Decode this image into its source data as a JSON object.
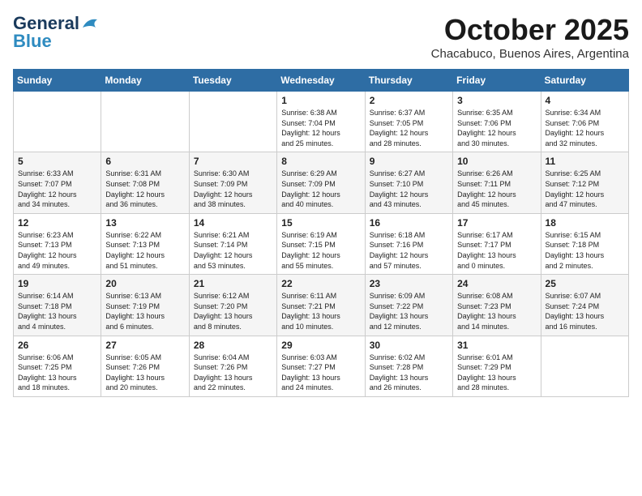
{
  "logo": {
    "line1": "General",
    "line2": "Blue"
  },
  "title": "October 2025",
  "subtitle": "Chacabuco, Buenos Aires, Argentina",
  "days_of_week": [
    "Sunday",
    "Monday",
    "Tuesday",
    "Wednesday",
    "Thursday",
    "Friday",
    "Saturday"
  ],
  "weeks": [
    [
      {
        "day": "",
        "content": ""
      },
      {
        "day": "",
        "content": ""
      },
      {
        "day": "",
        "content": ""
      },
      {
        "day": "1",
        "content": "Sunrise: 6:38 AM\nSunset: 7:04 PM\nDaylight: 12 hours\nand 25 minutes."
      },
      {
        "day": "2",
        "content": "Sunrise: 6:37 AM\nSunset: 7:05 PM\nDaylight: 12 hours\nand 28 minutes."
      },
      {
        "day": "3",
        "content": "Sunrise: 6:35 AM\nSunset: 7:06 PM\nDaylight: 12 hours\nand 30 minutes."
      },
      {
        "day": "4",
        "content": "Sunrise: 6:34 AM\nSunset: 7:06 PM\nDaylight: 12 hours\nand 32 minutes."
      }
    ],
    [
      {
        "day": "5",
        "content": "Sunrise: 6:33 AM\nSunset: 7:07 PM\nDaylight: 12 hours\nand 34 minutes."
      },
      {
        "day": "6",
        "content": "Sunrise: 6:31 AM\nSunset: 7:08 PM\nDaylight: 12 hours\nand 36 minutes."
      },
      {
        "day": "7",
        "content": "Sunrise: 6:30 AM\nSunset: 7:09 PM\nDaylight: 12 hours\nand 38 minutes."
      },
      {
        "day": "8",
        "content": "Sunrise: 6:29 AM\nSunset: 7:09 PM\nDaylight: 12 hours\nand 40 minutes."
      },
      {
        "day": "9",
        "content": "Sunrise: 6:27 AM\nSunset: 7:10 PM\nDaylight: 12 hours\nand 43 minutes."
      },
      {
        "day": "10",
        "content": "Sunrise: 6:26 AM\nSunset: 7:11 PM\nDaylight: 12 hours\nand 45 minutes."
      },
      {
        "day": "11",
        "content": "Sunrise: 6:25 AM\nSunset: 7:12 PM\nDaylight: 12 hours\nand 47 minutes."
      }
    ],
    [
      {
        "day": "12",
        "content": "Sunrise: 6:23 AM\nSunset: 7:13 PM\nDaylight: 12 hours\nand 49 minutes."
      },
      {
        "day": "13",
        "content": "Sunrise: 6:22 AM\nSunset: 7:13 PM\nDaylight: 12 hours\nand 51 minutes."
      },
      {
        "day": "14",
        "content": "Sunrise: 6:21 AM\nSunset: 7:14 PM\nDaylight: 12 hours\nand 53 minutes."
      },
      {
        "day": "15",
        "content": "Sunrise: 6:19 AM\nSunset: 7:15 PM\nDaylight: 12 hours\nand 55 minutes."
      },
      {
        "day": "16",
        "content": "Sunrise: 6:18 AM\nSunset: 7:16 PM\nDaylight: 12 hours\nand 57 minutes."
      },
      {
        "day": "17",
        "content": "Sunrise: 6:17 AM\nSunset: 7:17 PM\nDaylight: 13 hours\nand 0 minutes."
      },
      {
        "day": "18",
        "content": "Sunrise: 6:15 AM\nSunset: 7:18 PM\nDaylight: 13 hours\nand 2 minutes."
      }
    ],
    [
      {
        "day": "19",
        "content": "Sunrise: 6:14 AM\nSunset: 7:18 PM\nDaylight: 13 hours\nand 4 minutes."
      },
      {
        "day": "20",
        "content": "Sunrise: 6:13 AM\nSunset: 7:19 PM\nDaylight: 13 hours\nand 6 minutes."
      },
      {
        "day": "21",
        "content": "Sunrise: 6:12 AM\nSunset: 7:20 PM\nDaylight: 13 hours\nand 8 minutes."
      },
      {
        "day": "22",
        "content": "Sunrise: 6:11 AM\nSunset: 7:21 PM\nDaylight: 13 hours\nand 10 minutes."
      },
      {
        "day": "23",
        "content": "Sunrise: 6:09 AM\nSunset: 7:22 PM\nDaylight: 13 hours\nand 12 minutes."
      },
      {
        "day": "24",
        "content": "Sunrise: 6:08 AM\nSunset: 7:23 PM\nDaylight: 13 hours\nand 14 minutes."
      },
      {
        "day": "25",
        "content": "Sunrise: 6:07 AM\nSunset: 7:24 PM\nDaylight: 13 hours\nand 16 minutes."
      }
    ],
    [
      {
        "day": "26",
        "content": "Sunrise: 6:06 AM\nSunset: 7:25 PM\nDaylight: 13 hours\nand 18 minutes."
      },
      {
        "day": "27",
        "content": "Sunrise: 6:05 AM\nSunset: 7:26 PM\nDaylight: 13 hours\nand 20 minutes."
      },
      {
        "day": "28",
        "content": "Sunrise: 6:04 AM\nSunset: 7:26 PM\nDaylight: 13 hours\nand 22 minutes."
      },
      {
        "day": "29",
        "content": "Sunrise: 6:03 AM\nSunset: 7:27 PM\nDaylight: 13 hours\nand 24 minutes."
      },
      {
        "day": "30",
        "content": "Sunrise: 6:02 AM\nSunset: 7:28 PM\nDaylight: 13 hours\nand 26 minutes."
      },
      {
        "day": "31",
        "content": "Sunrise: 6:01 AM\nSunset: 7:29 PM\nDaylight: 13 hours\nand 28 minutes."
      },
      {
        "day": "",
        "content": ""
      }
    ]
  ]
}
